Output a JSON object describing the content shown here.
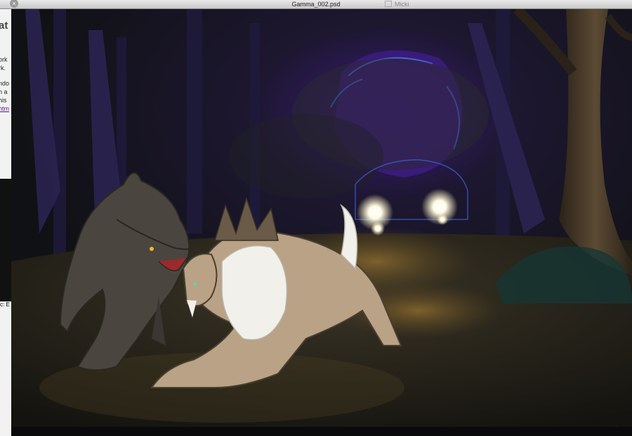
{
  "window": {
    "title": "Gamma_002.psd",
    "background_tab": "Micki",
    "close_glyph": "×"
  },
  "background_app": {
    "heading": "at",
    "lines": [
      "!",
      "ork",
      "rk.",
      "ndo",
      "n a",
      "his",
      "htm"
    ],
    "field_label": "c: E"
  },
  "canvas": {
    "signature_mark": "★"
  },
  "colors": {
    "night_sky": "#121318",
    "purple_glow": "#3a1a7a",
    "headlight": "#fffbe6",
    "wolf_dark": "#4a463f",
    "wolf_tan": "#b9a285",
    "ruff_white": "#f1f0ea"
  },
  "icons": [
    "close-icon",
    "tab-box-icon"
  ]
}
